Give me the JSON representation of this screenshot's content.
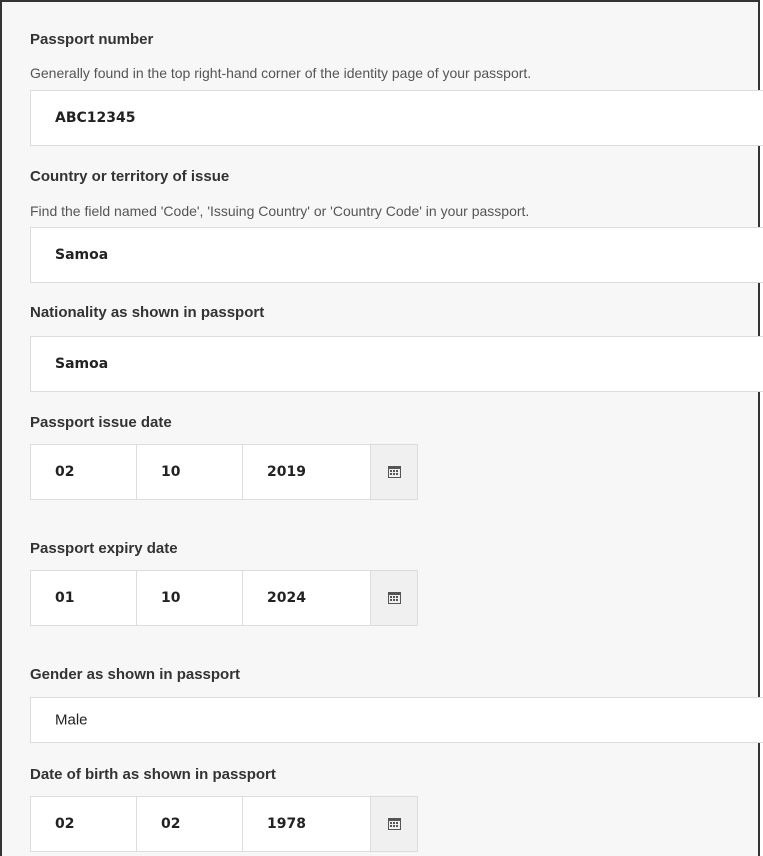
{
  "passport_number": {
    "label": "Passport number",
    "hint": "Generally found in the top right-hand corner of the identity page of your passport.",
    "value": "ABC12345"
  },
  "country_of_issue": {
    "label": "Country or territory of issue",
    "hint": "Find the field named 'Code', 'Issuing Country' or 'Country Code' in your passport.",
    "value": "Samoa"
  },
  "nationality": {
    "label": "Nationality as shown in passport",
    "value": "Samoa"
  },
  "issue_date": {
    "label": "Passport issue date",
    "day": "02",
    "month": "10",
    "year": "2019",
    "icon": "calendar-icon"
  },
  "expiry_date": {
    "label": "Passport expiry date",
    "day": "01",
    "month": "10",
    "year": "2024",
    "icon": "calendar-icon"
  },
  "gender": {
    "label": "Gender as shown in passport",
    "value": "Male"
  },
  "date_of_birth": {
    "label": "Date of birth as shown in passport",
    "day": "02",
    "month": "02",
    "year": "1978",
    "icon": "calendar-icon"
  },
  "colors": {
    "panel_background": "#f7f7f7",
    "field_border": "#dcdcdc",
    "calendar_button_background": "#f0f0f0",
    "text": "#333333"
  }
}
